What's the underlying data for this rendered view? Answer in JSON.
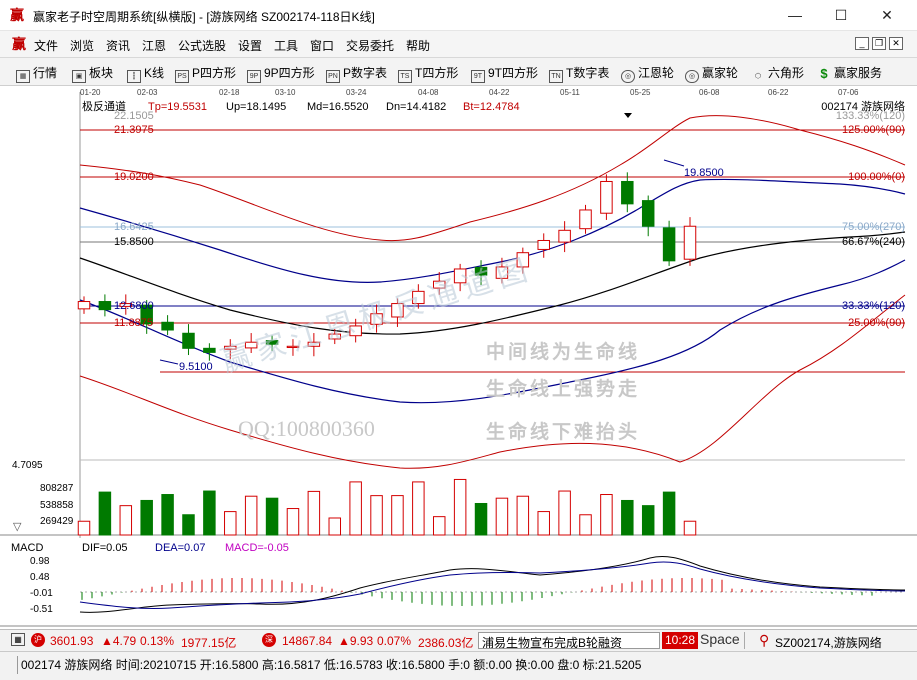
{
  "window": {
    "title": "赢家老子时空周期系统[纵横版] - [游族网络  SZ002174-118日K线]",
    "app_icon_text": "赢",
    "minimize": "—",
    "maximize": "☐",
    "close": "✕"
  },
  "menu": {
    "items": [
      "文件",
      "浏览",
      "资讯",
      "江恩",
      "公式选股",
      "设置",
      "工具",
      "窗口",
      "交易委托",
      "帮助"
    ]
  },
  "toolbar": {
    "items": [
      {
        "label": "行情",
        "icon": "grid-icon",
        "glyph": "▦"
      },
      {
        "label": "板块",
        "icon": "blocks-icon",
        "glyph": "▣"
      },
      {
        "label": "K线",
        "icon": "candle-icon",
        "glyph": "┇"
      },
      {
        "label": "P四方形",
        "icon": "p-square-icon",
        "glyph": "PS"
      },
      {
        "label": "9P四方形",
        "icon": "9p-square-icon",
        "glyph": "9P"
      },
      {
        "label": "P数字表",
        "icon": "p-table-icon",
        "glyph": "PN"
      },
      {
        "label": "T四方形",
        "icon": "t-square-icon",
        "glyph": "TS"
      },
      {
        "label": "9T四方形",
        "icon": "9t-square-icon",
        "glyph": "9T"
      },
      {
        "label": "T数字表",
        "icon": "t-table-icon",
        "glyph": "TN"
      },
      {
        "label": "江恩轮",
        "icon": "gann-wheel-icon",
        "glyph": "◎"
      },
      {
        "label": "赢家轮",
        "icon": "winner-wheel-icon",
        "glyph": "◎"
      },
      {
        "label": "六角形",
        "icon": "hexagon-icon",
        "glyph": "⬡"
      },
      {
        "label": "赢家服务",
        "icon": "dollar-icon",
        "glyph": "$"
      }
    ]
  },
  "chart": {
    "period_label": "日K线",
    "date_ticks": [
      "01-20",
      "02-03",
      "02-18",
      "03-10",
      "03-24",
      "04-08",
      "04-22",
      "05-11",
      "05-25",
      "06-08",
      "06-22",
      "07-06"
    ],
    "indicator_name": "极反通道",
    "tp": "Tp=19.5531",
    "up": "Up=18.1495",
    "md": "Md=16.5520",
    "dn": "Dn=14.4182",
    "bt": "Bt=12.4784",
    "stock_title": "002174  游族网络",
    "top_cut_label": "22.1505",
    "top_cut_right": "133.33%(120)",
    "levels": [
      {
        "price": "21.3975",
        "pct": "125.00%(90)"
      },
      {
        "price": "19.0200",
        "pct": "100.00%(0)"
      },
      {
        "price": "16.6425",
        "pct": "75.00%(270)"
      },
      {
        "price": "15.8500",
        "pct": "66.67%(240)"
      },
      {
        "price": "12.6800",
        "pct": "33.33%(120)"
      },
      {
        "price": "11.8875",
        "pct": "25.00%(90)"
      }
    ],
    "high_label": "19.8500",
    "low_label": "9.5100",
    "watermark_main": "赢家江恩极反通道图",
    "annotations": [
      "中间线为生命线",
      "生命线上强势走",
      "生命线下难抬头"
    ],
    "qq": "QQ:100800360",
    "vol_axis": [
      "4.7095",
      "808287",
      "538858",
      "269429"
    ],
    "vol_scroll": "▽",
    "macd_title": "MACD",
    "dif": "DIF=0.05",
    "dea": "DEA=0.07",
    "macd": "MACD=-0.05",
    "macd_axis": [
      "0.98",
      "0.48",
      "-0.01",
      "-0.51"
    ],
    "colors": {
      "up": "#d40000",
      "down": "#007a00",
      "blue": "#00008b",
      "level": "#c00000",
      "bg": "#ffffff"
    }
  },
  "status": {
    "sh_index": "3601.93",
    "sh_change": "▲4.79",
    "sh_pct": "0.13%",
    "sh_amount": "1977.15亿",
    "sz_index": "14867.84",
    "sz_change": "▲9.93",
    "sz_pct": "0.07%",
    "sz_amount": "2386.03亿",
    "news": "浦易生物宣布完成B轮融资",
    "time": "10:28",
    "space": "Space",
    "stock": "SZ002174,游族网络"
  },
  "info": {
    "text": "002174 游族网络 时间:20210715 开:16.5800 高:16.5817 低:16.5783 收:16.5800 手:0 额:0.00 换:0.00 盘:0 标:21.5205"
  },
  "chart_data": {
    "type": "candlestick",
    "title": "游族网络 SZ002174 日K线",
    "x": [
      "01-20",
      "02-03",
      "02-18",
      "03-10",
      "03-24",
      "04-08",
      "04-22",
      "05-11",
      "05-25",
      "06-08",
      "06-22",
      "07-06"
    ],
    "ylim": [
      9.0,
      22.2
    ],
    "close_approx": [
      12.9,
      12.5,
      12.8,
      11.8,
      11.5,
      10.6,
      10.4,
      10.7,
      10.9,
      10.8,
      10.7,
      10.9,
      11.3,
      11.7,
      12.3,
      12.8,
      13.4,
      13.9,
      14.5,
      14.2,
      14.6,
      15.3,
      15.9,
      16.4,
      17.4,
      18.8,
      17.7,
      16.6,
      14.9,
      16.6
    ],
    "series": [
      {
        "name": "Tp",
        "last": 19.5531
      },
      {
        "name": "Up",
        "last": 18.1495
      },
      {
        "name": "Md",
        "last": 16.552
      },
      {
        "name": "Dn",
        "last": 14.4182
      },
      {
        "name": "Bt",
        "last": 12.4784
      }
    ],
    "levels": [
      21.3975,
      19.02,
      16.6425,
      15.85,
      12.68,
      11.8875
    ],
    "high": 19.85,
    "low": 9.51
  }
}
